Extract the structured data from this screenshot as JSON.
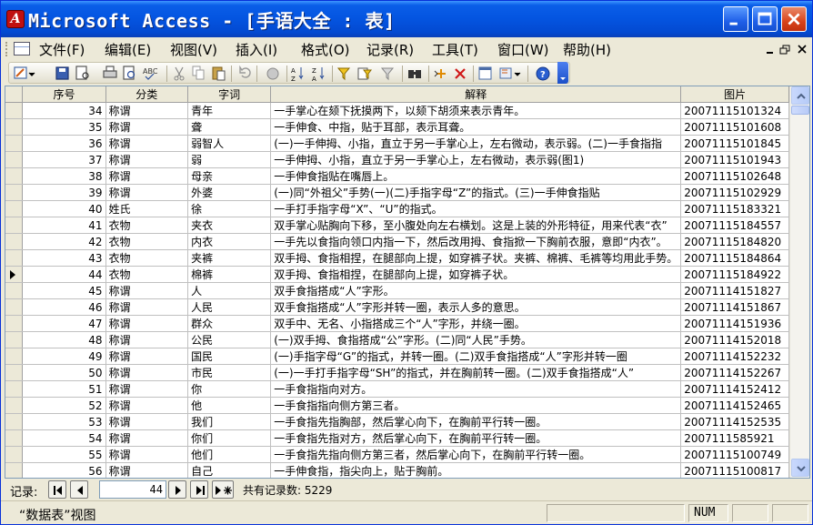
{
  "titlebar": {
    "title": "Microsoft Access - [手语大全 : 表]"
  },
  "menu": {
    "items": [
      "文件(F)",
      "编辑(E)",
      "视图(V)",
      "插入(I)",
      "格式(O)",
      "记录(R)",
      "工具(T)",
      "窗口(W)",
      "帮助(H)"
    ]
  },
  "toolbar": {
    "buttons": [
      "view-icon",
      "save-icon",
      "file-search-icon",
      "print-icon",
      "print-preview-icon",
      "spelling-icon",
      "cut-icon",
      "copy-icon",
      "paste-icon",
      "undo-icon",
      "hyperlink-icon",
      "sort-ascending-icon",
      "sort-descending-icon",
      "filter-by-selection-icon",
      "filter-by-form-icon",
      "apply-filter-icon",
      "find-icon",
      "new-record-icon",
      "delete-record-icon",
      "database-window-icon",
      "new-object-icon",
      "help-icon"
    ]
  },
  "table": {
    "columns": [
      "序号",
      "分类",
      "字词",
      "解释",
      "图片"
    ],
    "rows": [
      [
        "34",
        "称谓",
        "青年",
        "一手掌心在颏下抚摸两下，以颏下胡须来表示青年。",
        "20071115101324"
      ],
      [
        "35",
        "称谓",
        "聋",
        "一手伸食、中指，贴于耳部，表示耳聋。",
        "20071115101608"
      ],
      [
        "36",
        "称谓",
        "弱智人",
        "(一)一手伸拇、小指，直立于另一手掌心上，左右微动，表示弱。(二)一手食指指",
        "20071115101845"
      ],
      [
        "37",
        "称谓",
        "弱",
        "一手伸拇、小指，直立于另一手掌心上，左右微动，表示弱(图1)",
        "20071115101943"
      ],
      [
        "38",
        "称谓",
        "母亲",
        "一手伸食指贴在嘴唇上。",
        "20071115102648"
      ],
      [
        "39",
        "称谓",
        "外婆",
        "(一)同“外祖父”手势(一)(二)手指字母“Z”的指式。(三)一手伸食指贴",
        "20071115102929"
      ],
      [
        "40",
        "姓氏",
        "徐",
        "一手打手指字母“X”、“U”的指式。",
        "20071115183321"
      ],
      [
        "41",
        "衣物",
        "夹衣",
        "双手掌心贴胸向下移，至小腹处向左右横划。这是上装的外形特征，用来代表“衣”",
        "20071115184557"
      ],
      [
        "42",
        "衣物",
        "内衣",
        "一手先以食指向领口内指一下，然后改用拇、食指掀一下胸前衣服，意即“内衣”。",
        "20071115184820"
      ],
      [
        "43",
        "衣物",
        "夹裤",
        "双手拇、食指相捏，在腿部向上提，如穿裤子状。夹裤、棉裤、毛裤等均用此手势。",
        "20071115184864"
      ],
      [
        "44",
        "衣物",
        "棉裤",
        "双手拇、食指相捏，在腿部向上提，如穿裤子状。",
        "20071115184922"
      ],
      [
        "45",
        "称谓",
        "人",
        "双手食指搭成“人”字形。",
        "20071114151827"
      ],
      [
        "46",
        "称谓",
        "人民",
        "双手食指搭成“人”字形并转一圈，表示人多的意思。",
        "20071114151867"
      ],
      [
        "47",
        "称谓",
        "群众",
        "双手中、无名、小指搭成三个“人”字形，并绕一圈。",
        "20071114151936"
      ],
      [
        "48",
        "称谓",
        "公民",
        "(一)双手拇、食指搭成“公”字形。(二)同“人民”手势。",
        "20071114152018"
      ],
      [
        "49",
        "称谓",
        "国民",
        "(一)手指字母“G”的指式，并转一圈。(二)双手食指搭成“人”字形并转一圈",
        "20071114152232"
      ],
      [
        "50",
        "称谓",
        "市民",
        "(一)一手打手指字母“SH”的指式，并在胸前转一圈。(二)双手食指搭成“人”",
        "20071114152267"
      ],
      [
        "51",
        "称谓",
        "你",
        "一手食指指向对方。",
        "20071114152412"
      ],
      [
        "52",
        "称谓",
        "他",
        "一手食指指向侧方第三者。",
        "20071114152465"
      ],
      [
        "53",
        "称谓",
        "我们",
        "一手食指先指胸部，然后掌心向下，在胸前平行转一圈。",
        "20071114152535"
      ],
      [
        "54",
        "称谓",
        "你们",
        "一手食指先指对方，然后掌心向下，在胸前平行转一圈。",
        "2007111585921"
      ],
      [
        "55",
        "称谓",
        "他们",
        "一手食指先指向侧方第三者，然后掌心向下，在胸前平行转一圈。",
        "20071115100749"
      ],
      [
        "56",
        "称谓",
        "自己",
        "一手伸食指，指尖向上，贴于胸前。",
        "20071115100817"
      ]
    ],
    "current_row_index": 10
  },
  "navigator": {
    "label": "记录:",
    "current_record": "44",
    "total_text": "共有记录数: 5229"
  },
  "statusbar": {
    "view_text": "“数据表”视图",
    "num_indicator": "NUM"
  },
  "colors": {
    "titlebar": "#0454e0",
    "chrome": "#ece9d8",
    "grid_border": "#7f9db9"
  }
}
